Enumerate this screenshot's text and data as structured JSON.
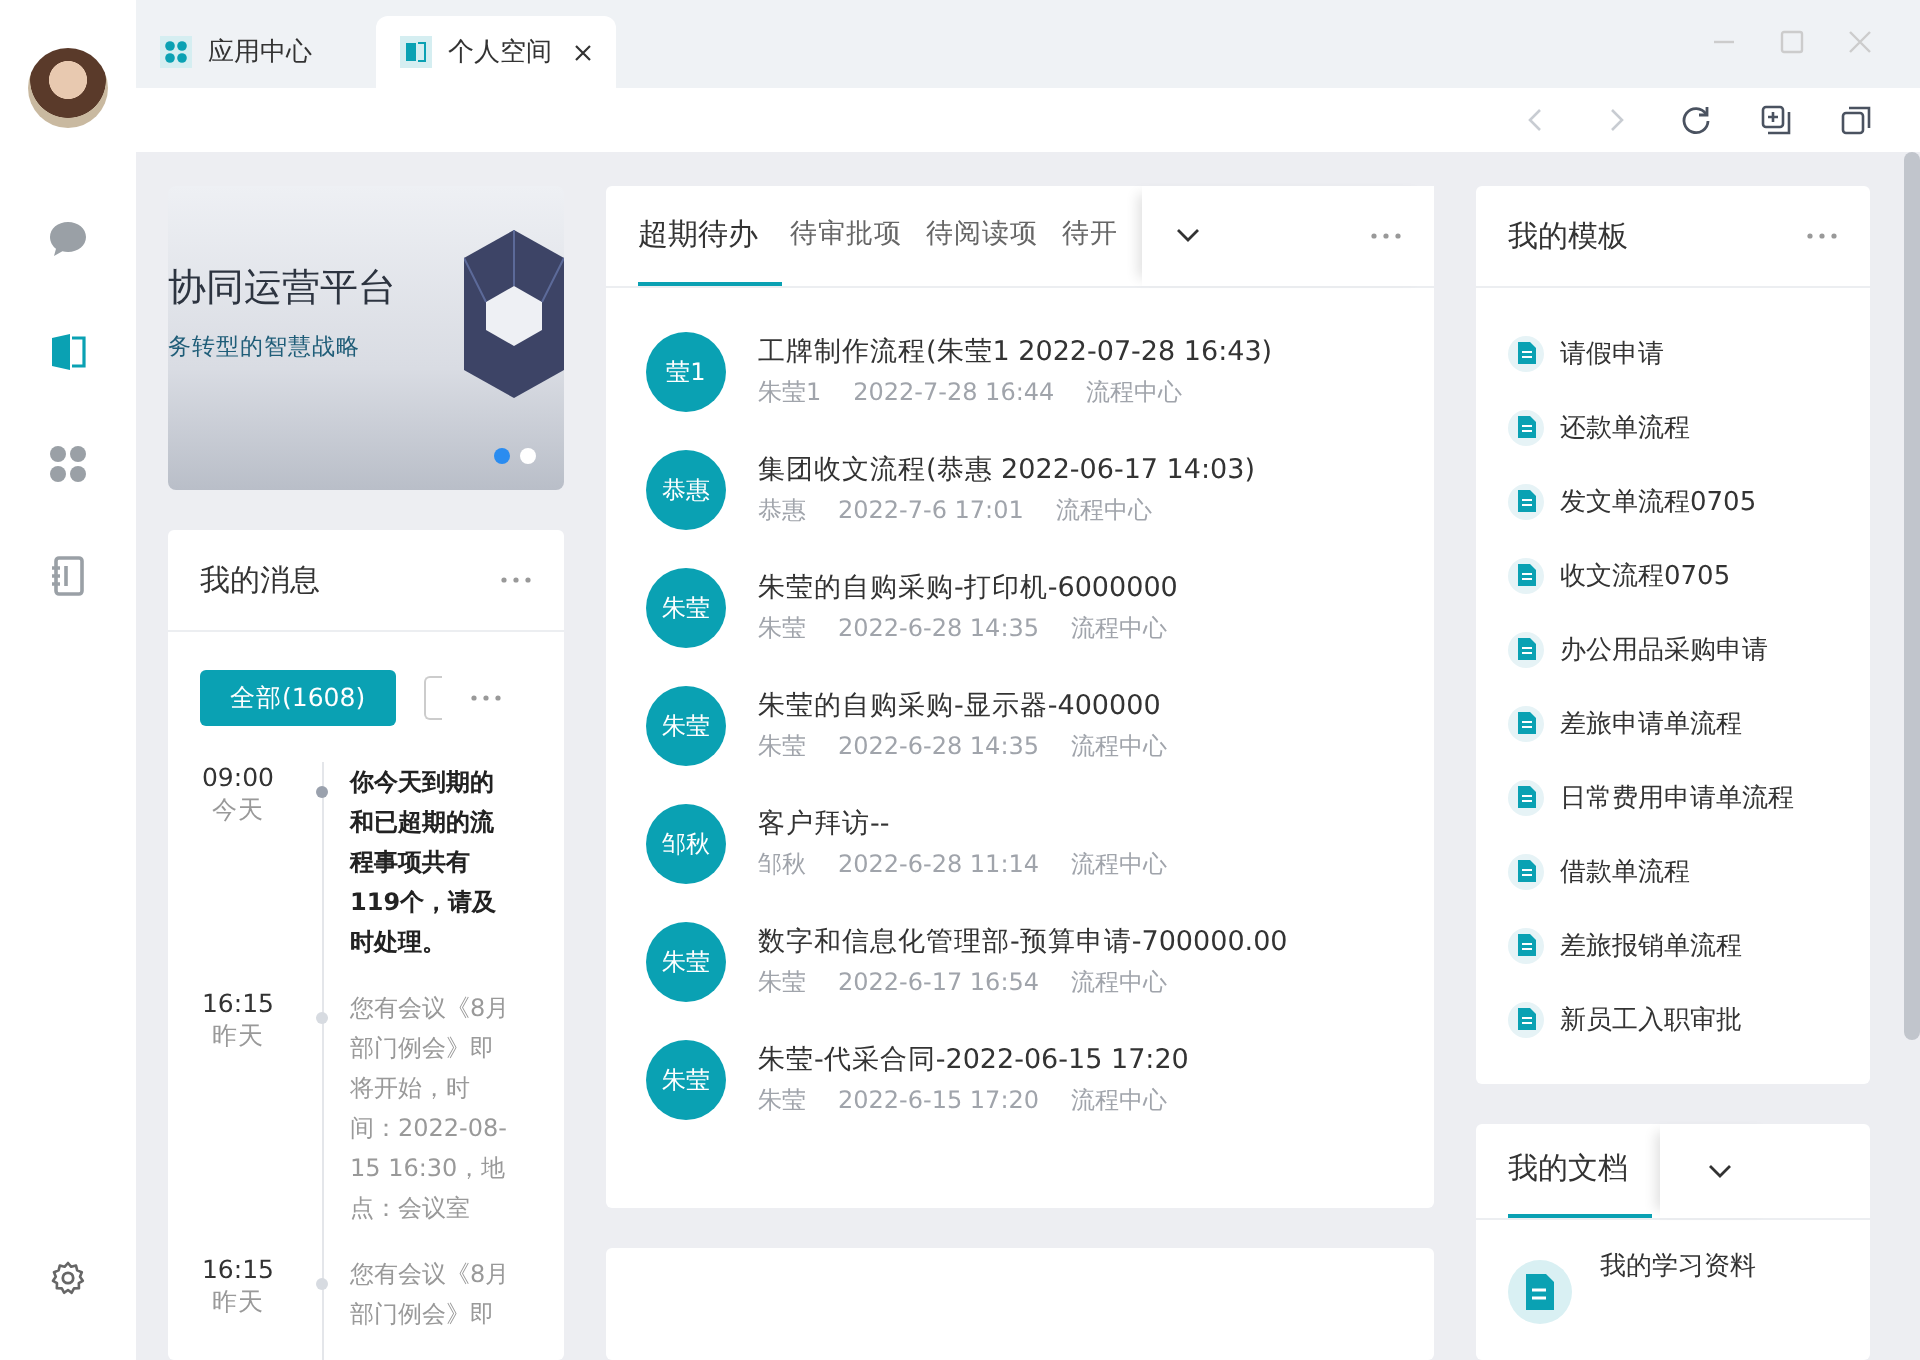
{
  "tabs": [
    {
      "label": "应用中心",
      "kind": "apps",
      "selected": false,
      "closable": false
    },
    {
      "label": "个人空间",
      "kind": "book",
      "selected": true,
      "closable": true
    }
  ],
  "toolbar": [
    {
      "kind": "back",
      "disabled": true
    },
    {
      "kind": "forward",
      "disabled": true
    },
    {
      "kind": "refresh",
      "disabled": false
    },
    {
      "kind": "new-window",
      "disabled": false
    },
    {
      "kind": "windows",
      "disabled": false
    }
  ],
  "sidebar": {
    "items": [
      {
        "kind": "chat",
        "selected": false
      },
      {
        "kind": "book",
        "selected": true
      },
      {
        "kind": "apps",
        "selected": false
      },
      {
        "kind": "notebook",
        "selected": false
      }
    ]
  },
  "banner": {
    "title": "协同运营平台",
    "subtitle": "务转型的智慧战略",
    "dots": [
      {
        "selected": true
      },
      {
        "selected": false
      }
    ]
  },
  "messages": {
    "title": "我的消息",
    "filters": [
      {
        "label": "全部(1608)",
        "selected": true
      }
    ],
    "items": [
      {
        "time": "09:00",
        "day": "今天",
        "text": "你今天到期的和已超期的流程事项共有119个，请及时处理。",
        "unread": true
      },
      {
        "time": "16:15",
        "day": "昨天",
        "text": "您有会议《8月部门例会》即将开始，时间：2022-08-15 16:30，地点：会议室",
        "unread": false
      },
      {
        "time": "16:15",
        "day": "昨天",
        "text": "您有会议《8月部门例会》即",
        "unread": false
      }
    ]
  },
  "todo": {
    "tabs": [
      {
        "label": "超期待办",
        "selected": true
      },
      {
        "label": "待审批项",
        "selected": false
      },
      {
        "label": "待阅读项",
        "selected": false
      },
      {
        "label": "待开",
        "selected": false
      }
    ],
    "items": [
      {
        "avatar": "莹1",
        "title": "工牌制作流程(朱莹1 2022-07-28 16:43)",
        "user": "朱莹1",
        "date": "2022-7-28 16:44",
        "source": "流程中心"
      },
      {
        "avatar": "恭惠",
        "title": "集团收文流程(恭惠 2022-06-17 14:03)",
        "user": "恭惠",
        "date": "2022-7-6 17:01",
        "source": "流程中心"
      },
      {
        "avatar": "朱莹",
        "title": "朱莹的自购采购-打印机-6000000",
        "user": "朱莹",
        "date": "2022-6-28 14:35",
        "source": "流程中心"
      },
      {
        "avatar": "朱莹",
        "title": "朱莹的自购采购-显示器-400000",
        "user": "朱莹",
        "date": "2022-6-28 14:35",
        "source": "流程中心"
      },
      {
        "avatar": "邹秋",
        "title": "客户拜访--",
        "user": "邹秋",
        "date": "2022-6-28 11:14",
        "source": "流程中心"
      },
      {
        "avatar": "朱莹",
        "title": "数字和信息化管理部-预算申请-700000.00",
        "user": "朱莹",
        "date": "2022-6-17 16:54",
        "source": "流程中心"
      },
      {
        "avatar": "朱莹",
        "title": "朱莹-代采合同-2022-06-15 17:20",
        "user": "朱莹",
        "date": "2022-6-15 17:20",
        "source": "流程中心"
      }
    ]
  },
  "templates": {
    "title": "我的模板",
    "items": [
      "请假申请",
      "还款单流程",
      "发文单流程0705",
      "收文流程0705",
      "办公用品采购申请",
      "差旅申请单流程",
      "日常费用申请单流程",
      "借款单流程",
      "差旅报销单流程",
      "新员工入职审批"
    ]
  },
  "documents": {
    "tabs": [
      {
        "label": "我的文档",
        "selected": true
      }
    ],
    "items": [
      "我的学习资料"
    ]
  }
}
